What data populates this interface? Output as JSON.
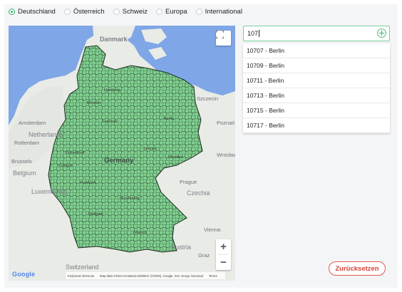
{
  "regions": [
    {
      "label": "Deutschland",
      "selected": true
    },
    {
      "label": "Österreich",
      "selected": false
    },
    {
      "label": "Schweiz",
      "selected": false
    },
    {
      "label": "Europa",
      "selected": false
    },
    {
      "label": "International",
      "selected": false
    }
  ],
  "map": {
    "countries": {
      "netherlands": "Netherlands",
      "belgium": "Belgium",
      "luxembourg": "Luxembourg",
      "czechia": "Czechia",
      "austria": "Austria",
      "denmark": "Danmark",
      "switzerland": "Switzerland",
      "germany": "Germany"
    },
    "cities": {
      "amsterdam": "Amsterdam",
      "rotterdam": "Rotterdam",
      "brussels": "Brussels",
      "prague": "Prague",
      "vienna": "Vienna",
      "graz": "Graz",
      "wroclaw": "Wrocław",
      "poznan": "Poznań",
      "szczecin": "Szczecin",
      "hamburg": "Hamburg",
      "bremen": "Bremen",
      "hanover": "Hanover",
      "berlin": "Berlin",
      "leipzig": "Leipzig",
      "dresden": "Dresden",
      "frankfurt": "Frankfurt",
      "nuremberg": "Nuremberg",
      "stuttgart": "Stuttgart",
      "munich": "Munich",
      "cologne": "Cologne",
      "dusseldorf": "Düsseldorf"
    },
    "google": "Google",
    "attribution": {
      "shortcuts": "Keyboard shortcuts",
      "data": "Map data ©2024 GeoBasis-DE/BKG (©2009), Google, Inst. Geogr. Nacional",
      "terms": "Terms"
    },
    "zoom_in": "+",
    "zoom_out": "−",
    "colors": {
      "water": "#7fa6e6",
      "land": "#e9ebe6",
      "postal_fill": "#7fd08f",
      "postal_border": "#1e2b22"
    }
  },
  "search": {
    "value": "107"
  },
  "results": [
    "10707 - Berlin",
    "10709 - Berlin",
    "10711 - Berlin",
    "10713 - Berlin",
    "10715 - Berlin",
    "10717 - Berlin"
  ],
  "reset_label": "Zurücksetzen",
  "accent": "#35b26b",
  "danger": "#e55a4e"
}
